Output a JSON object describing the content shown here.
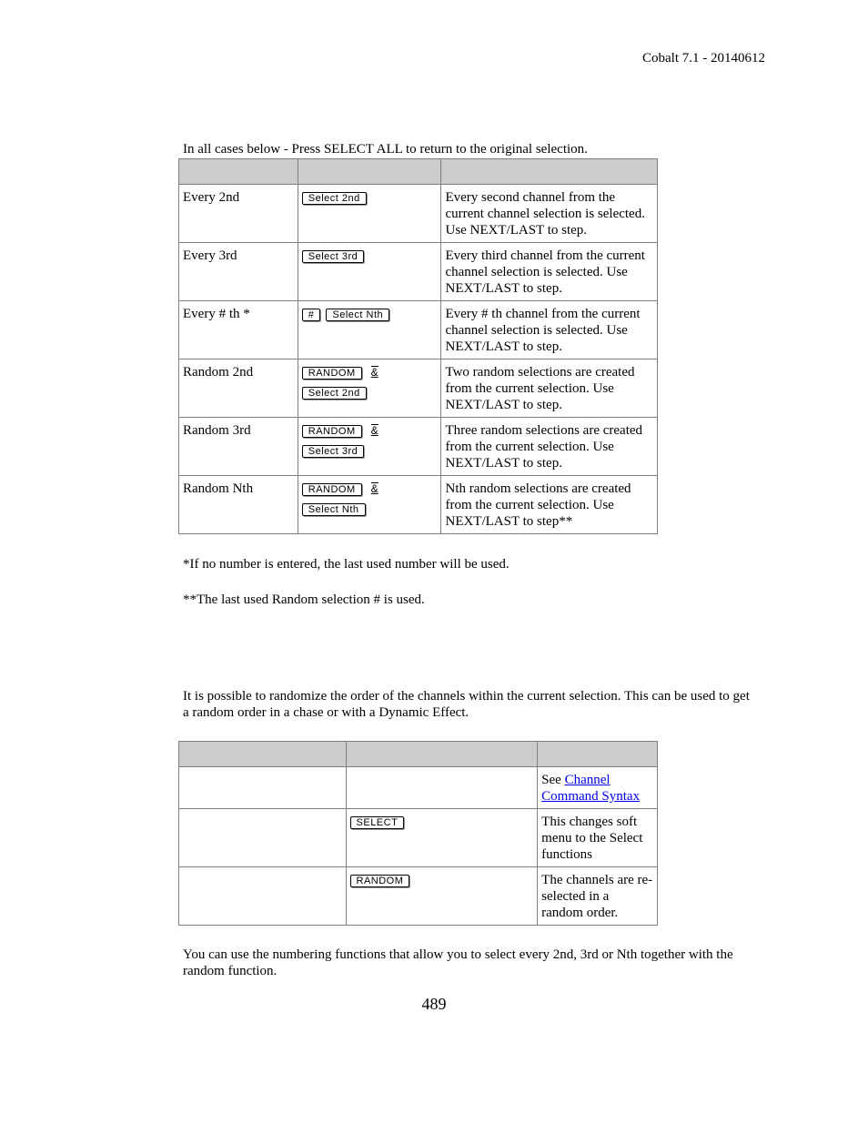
{
  "header": {
    "version": "Cobalt 7.1 - 20140612"
  },
  "intro": "In all cases below - Press SELECT ALL to return to the original selection.",
  "table1": {
    "headers": [
      "",
      "",
      ""
    ],
    "rows": [
      {
        "name": "Every 2nd",
        "keys": [
          [
            "Select 2nd"
          ]
        ],
        "desc": "Every second channel from the current channel selection is selected. Use NEXT/LAST to step."
      },
      {
        "name": "Every 3rd",
        "keys": [
          [
            "Select 3rd"
          ]
        ],
        "desc": "Every third channel from the current channel selection is selected. Use NEXT/LAST to step."
      },
      {
        "name": "Every # th *",
        "keys": [
          [
            "#",
            "Select Nth"
          ]
        ],
        "desc": "Every # th channel from the current channel selection is selected. Use NEXT/LAST to step."
      },
      {
        "name": "Random 2nd",
        "keys": [
          [
            "RANDOM",
            "&"
          ],
          [
            "Select 2nd"
          ]
        ],
        "desc": "Two random selections are created from the current selection. Use NEXT/LAST to step."
      },
      {
        "name": "Random 3rd",
        "keys": [
          [
            "RANDOM",
            "&"
          ],
          [
            "Select 3rd"
          ]
        ],
        "desc": "Three random selections are created from the current selection. Use NEXT/LAST to step."
      },
      {
        "name": "Random Nth",
        "keys": [
          [
            "RANDOM",
            "&"
          ],
          [
            "Select Nth"
          ]
        ],
        "desc": "Nth random selections are created from the current selection. Use NEXT/LAST to step**"
      }
    ]
  },
  "footnote1": "*If no number is entered, the last used number will be used.",
  "footnote2": "**The last used Random selection # is used.",
  "para1": "It is possible to randomize the order of the channels within the current selection. This can be used to get a random order in a chase or with a Dynamic Effect.",
  "table2": {
    "row1": {
      "see": "See ",
      "link": "Channel Command Syntax"
    },
    "row2": {
      "key": "SELECT",
      "desc": "This changes soft menu to the Select functions"
    },
    "row3": {
      "key": "RANDOM",
      "desc": "The channels are re-selected in a random order."
    }
  },
  "para2": "You can use the numbering functions that allow you to select every 2nd, 3rd or Nth together with the random function.",
  "page_number": "489"
}
